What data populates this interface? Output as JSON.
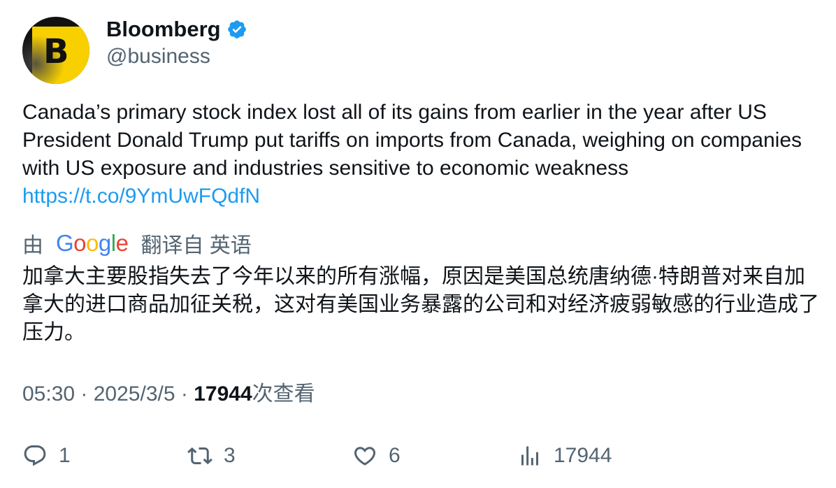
{
  "author": {
    "display_name": "Bloomberg",
    "handle": "@business",
    "avatar_letter": "B",
    "verified": true
  },
  "tweet": {
    "text": "Canada’s primary stock index lost all of its gains from earlier in the year after US President Donald Trump put tariffs on imports from Canada, weighing on companies with US exposure and industries sensitive to economic weakness",
    "link": "https://t.co/9YmUwFQdfN"
  },
  "translation": {
    "prefix": "由",
    "provider": "Google",
    "suffix": "翻译自 英语",
    "text": "加拿大主要股指失去了今年以来的所有涨幅，原因是美国总统唐纳德·特朗普对来自加拿大的进口商品加征关税，这对有美国业务暴露的公司和对经济疲弱敏感的行业造成了压力。"
  },
  "meta": {
    "time": "05:30",
    "separator": " · ",
    "date": "2025/3/5",
    "views_count": "17944",
    "views_label": "次查看"
  },
  "actions": {
    "replies": "1",
    "retweets": "3",
    "likes": "6",
    "views": "17944"
  },
  "colors": {
    "text": "#0f1419",
    "secondary": "#536471",
    "link": "#1d9bf0",
    "verified": "#1d9bf0",
    "brand_yellow": "#f8d000"
  },
  "icons": [
    "verified-badge-icon",
    "reply-icon",
    "retweet-icon",
    "like-icon",
    "views-icon"
  ]
}
